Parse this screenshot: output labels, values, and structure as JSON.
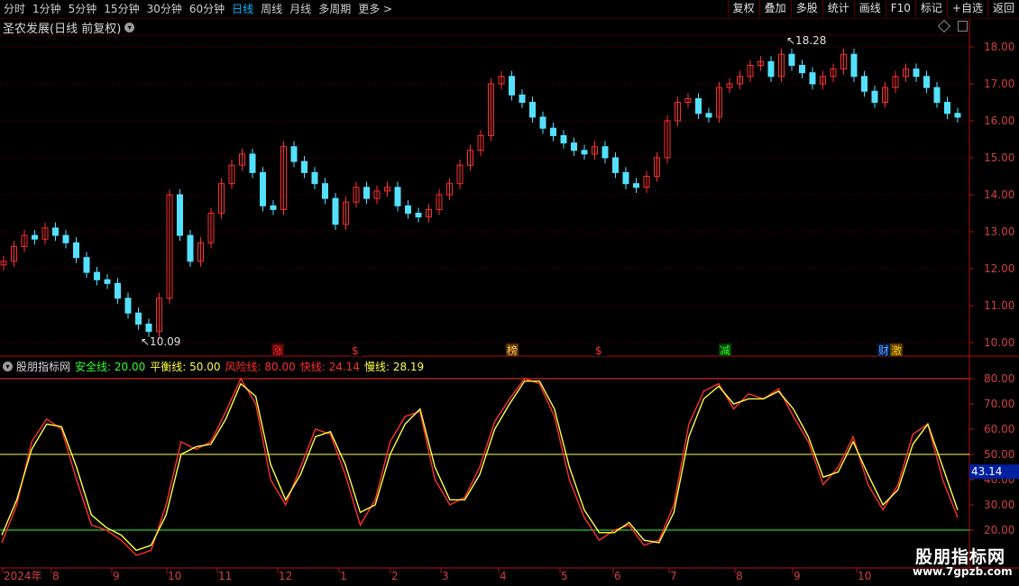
{
  "toolbar": {
    "periods": [
      "分时",
      "1分钟",
      "5分钟",
      "15分钟",
      "30分钟",
      "60分钟",
      "日线",
      "周线",
      "月线",
      "多周期",
      "更多 >"
    ],
    "selected_period": "日线",
    "buttons": [
      "复权",
      "叠加",
      "多股",
      "统计",
      "画线",
      "F10",
      "标记",
      "+自选",
      "返回"
    ]
  },
  "chart_title": "圣农发展(日线 前复权)",
  "price_axis": {
    "ticks": [
      "18.00",
      "17.00",
      "16.00",
      "15.00",
      "14.00",
      "13.00",
      "12.00",
      "11.00",
      "10.00"
    ]
  },
  "price_annotations": {
    "high": "18.28",
    "low": "10.09"
  },
  "event_markers": [
    {
      "label": "涨",
      "color": "#ff3030",
      "bg": "#4a0000"
    },
    {
      "label": "$",
      "color": "#ff3030",
      "bg": "#000000"
    },
    {
      "label": "榜",
      "color": "#ffcc66",
      "bg": "#5a3000"
    },
    {
      "label": "$",
      "color": "#ff3030",
      "bg": "#000000"
    },
    {
      "label": "减",
      "color": "#30ff30",
      "bg": "#003a00"
    },
    {
      "label": "财",
      "color": "#60a8ff",
      "bg": "#001a4a"
    },
    {
      "label": "激",
      "color": "#ffcc00",
      "bg": "#5a3a00"
    }
  ],
  "indicator": {
    "name": "股朋指标网",
    "safe": {
      "label": "安全线:",
      "value": "20.00",
      "color": "#30ff30"
    },
    "balance": {
      "label": "平衡线:",
      "value": "50.00",
      "color": "#ffff40"
    },
    "risk": {
      "label": "风险线:",
      "value": "80.00",
      "color": "#ff3030"
    },
    "fast": {
      "label": "快线:",
      "value": "24.14",
      "color": "#ff3030"
    },
    "slow": {
      "label": "慢线:",
      "value": "28.19",
      "color": "#ffff40"
    }
  },
  "indicator_axis": {
    "ticks": [
      "80.00",
      "70.00",
      "60.00",
      "50.00",
      "40.00",
      "30.00",
      "20.00"
    ],
    "current": "43.14"
  },
  "date_axis": {
    "labels": [
      "2024年",
      "8",
      "9",
      "10",
      "11",
      "12",
      "1",
      "2",
      "3",
      "4",
      "5",
      "6",
      "7",
      "8",
      "9",
      "10"
    ]
  },
  "watermark": {
    "title": "股朋指标网",
    "url": "www.7gpzb.com"
  },
  "chart_data": {
    "type": "line",
    "series": [
      {
        "name": "快线",
        "color": "#ff3030",
        "values": [
          15,
          30,
          55,
          64,
          60,
          40,
          22,
          20,
          16,
          10,
          12,
          30,
          55,
          52,
          55,
          67,
          80,
          70,
          40,
          30,
          45,
          60,
          58,
          42,
          22,
          32,
          55,
          65,
          67,
          40,
          30,
          33,
          45,
          63,
          72,
          80,
          78,
          65,
          40,
          25,
          16,
          20,
          22,
          14,
          16,
          30,
          62,
          75,
          78,
          68,
          74,
          72,
          76,
          65,
          55,
          38,
          45,
          57,
          38,
          28,
          38,
          58,
          62,
          40,
          25
        ]
      },
      {
        "name": "慢线",
        "color": "#ffff40",
        "values": [
          18,
          32,
          52,
          62,
          61,
          45,
          26,
          21,
          18,
          12,
          14,
          26,
          50,
          53,
          54,
          64,
          78,
          73,
          46,
          32,
          42,
          57,
          59,
          46,
          27,
          30,
          50,
          62,
          68,
          45,
          32,
          32,
          42,
          60,
          70,
          79,
          79,
          68,
          45,
          28,
          19,
          19,
          23,
          16,
          15,
          27,
          57,
          72,
          77,
          70,
          72,
          72,
          75,
          68,
          57,
          41,
          43,
          55,
          42,
          30,
          36,
          54,
          62,
          45,
          28
        ]
      }
    ],
    "ylim": [
      15,
      85
    ],
    "reference_lines": [
      20,
      50,
      80
    ],
    "ohlc": [
      12.2,
      12.6,
      12.9,
      12.8,
      13.1,
      12.9,
      12.7,
      12.3,
      11.9,
      11.7,
      11.6,
      11.2,
      10.8,
      10.5,
      10.3,
      11.2,
      14.0,
      12.9,
      12.2,
      12.7,
      13.5,
      14.3,
      14.8,
      15.1,
      14.6,
      13.7,
      13.6,
      15.3,
      14.9,
      14.6,
      14.3,
      13.9,
      13.2,
      13.8,
      14.2,
      13.9,
      14.1,
      14.2,
      13.7,
      13.5,
      13.4,
      13.6,
      14.0,
      14.3,
      14.8,
      15.2,
      15.6,
      17.0,
      17.2,
      16.7,
      16.5,
      16.1,
      15.8,
      15.6,
      15.4,
      15.2,
      15.1,
      15.3,
      15.0,
      14.6,
      14.3,
      14.2,
      14.5,
      15.0,
      16.0,
      16.5,
      16.6,
      16.2,
      16.1,
      16.9,
      17.0,
      17.2,
      17.5,
      17.6,
      17.2,
      17.8,
      17.5,
      17.3,
      17.0,
      17.2,
      17.4,
      17.8,
      17.2,
      16.8,
      16.5,
      16.9,
      17.2,
      17.4,
      17.2,
      16.9,
      16.5,
      16.2,
      16.1
    ]
  }
}
